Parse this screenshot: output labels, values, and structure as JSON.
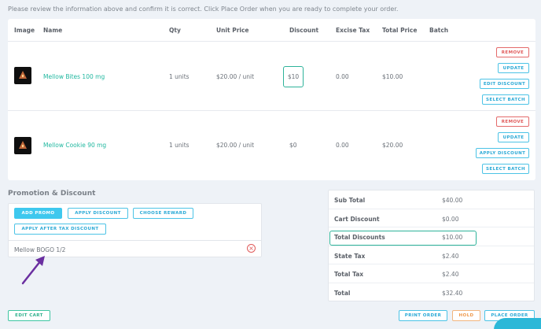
{
  "notice": "Please review the information above and confirm it is correct. Click Place Order when you are ready to complete your order.",
  "table": {
    "headers": [
      "Image",
      "Name",
      "Qty",
      "Unit Price",
      "Discount",
      "Excise Tax",
      "Total Price",
      "Batch"
    ],
    "rows": [
      {
        "image_icon": "product-thumbnail",
        "name": "Mellow Bites 100 mg",
        "qty": "1 units",
        "unit_price": "$20.00 / unit",
        "discount": "$10",
        "excise_tax": "0.00",
        "total_price": "$10.00",
        "buttons": [
          "REMOVE",
          "UPDATE",
          "EDIT DISCOUNT",
          "SELECT BATCH"
        ]
      },
      {
        "image_icon": "product-thumbnail",
        "name": "Mellow Cookie 90 mg",
        "qty": "1 units",
        "unit_price": "$20.00 / unit",
        "discount": "$0",
        "excise_tax": "0.00",
        "total_price": "$20.00",
        "buttons": [
          "REMOVE",
          "UPDATE",
          "APPLY DISCOUNT",
          "SELECT BATCH"
        ]
      }
    ]
  },
  "promo": {
    "title": "Promotion & Discount",
    "buttons": [
      "ADD PROMO",
      "APPLY DISCOUNT",
      "CHOOSE REWARD",
      "APPLY AFTER TAX DISCOUNT"
    ],
    "applied_promo": "Mellow BOGO 1/2"
  },
  "summary": {
    "rows": [
      {
        "label": "Sub Total",
        "value": "$40.00"
      },
      {
        "label": "Cart Discount",
        "value": "$0.00"
      },
      {
        "label": "Total Discounts",
        "value": "$10.00"
      },
      {
        "label": "State Tax",
        "value": "$2.40"
      },
      {
        "label": "Total Tax",
        "value": "$2.40"
      },
      {
        "label": "Total",
        "value": "$32.40"
      }
    ]
  },
  "footer": {
    "edit_cart": "EDIT CART",
    "print_order": "PRINT ORDER",
    "hold": "HOLD",
    "place_order": "PLACE ORDER"
  },
  "colors": {
    "teal": "#2eb39a",
    "blue": "#3ec8ee",
    "red": "#e05a5a",
    "orange": "#ef9a4e",
    "arrow": "#6a2fa0"
  }
}
